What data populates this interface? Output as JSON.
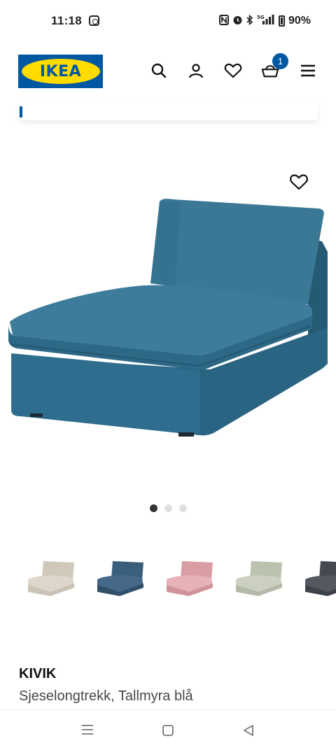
{
  "status_bar": {
    "time": "11:18",
    "network": "5G",
    "battery": "90%"
  },
  "header": {
    "logo_text": "IKEA",
    "cart_count": "1",
    "brand_blue": "#0058a3",
    "brand_yellow": "#ffdb00",
    "icons": [
      "search-icon",
      "account-icon",
      "heart-icon",
      "cart-icon",
      "menu-icon"
    ]
  },
  "gallery": {
    "dots": 3,
    "active_dot": 0,
    "main_color": "#2f6b89"
  },
  "color_options": [
    {
      "name": "beige",
      "color": "#dcd6cb"
    },
    {
      "name": "blue",
      "color": "#3f6482"
    },
    {
      "name": "pink",
      "color": "#e0a9ae"
    },
    {
      "name": "light-green",
      "color": "#c7ccbc"
    },
    {
      "name": "dark-grey",
      "color": "#4b4f57"
    }
  ],
  "product": {
    "name": "KIVIK",
    "description": "Sjeselongtrekk, Tallmyra blå"
  }
}
